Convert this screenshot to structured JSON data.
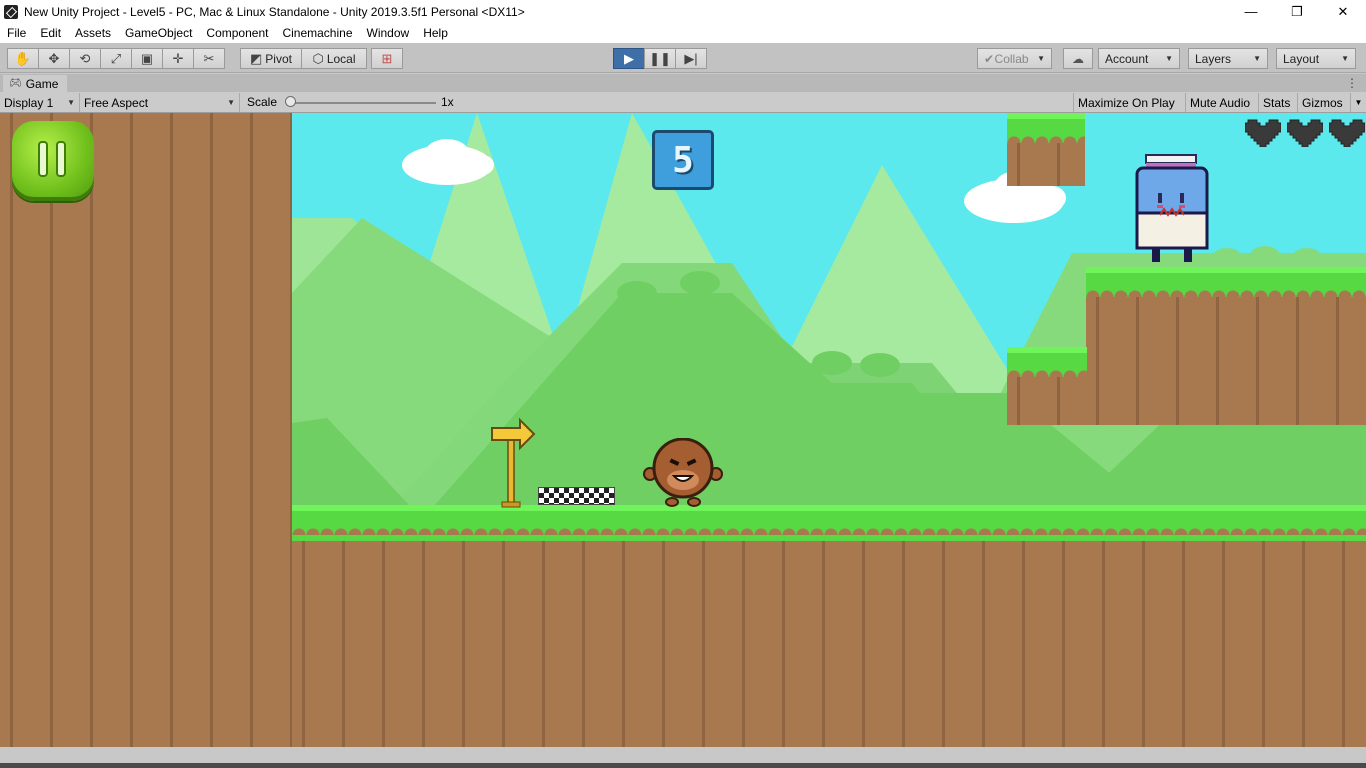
{
  "window": {
    "title": "New Unity Project - Level5 - PC, Mac & Linux Standalone - Unity 2019.3.5f1 Personal <DX11>",
    "minimize": "—",
    "maximize": "❐",
    "close": "✕"
  },
  "menu": [
    "File",
    "Edit",
    "Assets",
    "GameObject",
    "Component",
    "Cinemachine",
    "Window",
    "Help"
  ],
  "toolbar": {
    "tools": [
      "hand-icon",
      "move-icon",
      "rotate-icon",
      "scale-icon",
      "rect-icon",
      "transform-icon",
      "custom-tool-icon"
    ],
    "pivot_label": "Pivot",
    "local_label": "Local",
    "collab_label": "Collab",
    "account_label": "Account",
    "layers_label": "Layers",
    "layout_label": "Layout",
    "play_state": "playing"
  },
  "game_tab": {
    "label": "Game",
    "display": "Display 1",
    "aspect": "Free Aspect",
    "scale_label": "Scale",
    "scale_value": "1x",
    "maximize_on_play": "Maximize On Play",
    "mute_audio": "Mute Audio",
    "stats": "Stats",
    "gizmos": "Gizmos"
  },
  "game": {
    "score": "5",
    "lives_total": 3,
    "colors": {
      "sky": "#5ce9ed",
      "grass": "#57d943",
      "dirt": "#a8794f",
      "hill_light": "#a6ea9f",
      "hill_mid": "#83d97a",
      "hill_dark": "#6fcf63"
    },
    "elements": [
      "pause-button",
      "score-block",
      "hearts",
      "player-character",
      "enemy-milk-carton",
      "signpost-arrow",
      "checkpoint-flag",
      "clouds",
      "floating-platforms"
    ]
  }
}
